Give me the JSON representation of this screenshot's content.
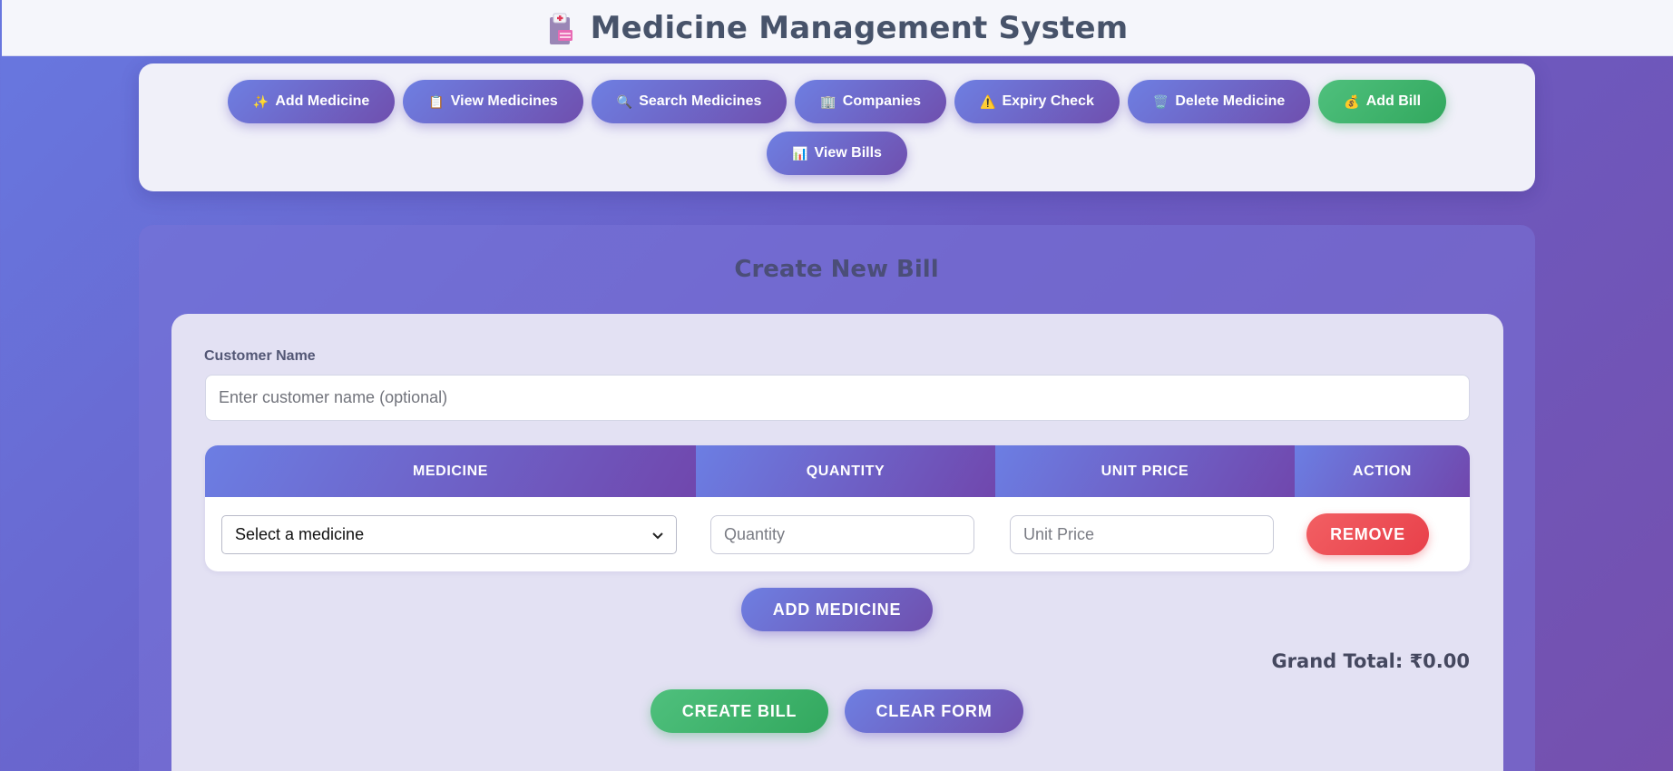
{
  "header": {
    "title": "Medicine Management System",
    "icon": "hospital-icon"
  },
  "nav": {
    "row1": [
      {
        "label": "Add Medicine",
        "icon": "sparkle-icon",
        "glyph": "✨"
      },
      {
        "label": "View Medicines",
        "icon": "clipboard-icon",
        "glyph": "📋"
      },
      {
        "label": "Search Medicines",
        "icon": "magnifier-icon",
        "glyph": "🔍"
      },
      {
        "label": "Companies",
        "icon": "building-icon",
        "glyph": "🏢"
      },
      {
        "label": "Expiry Check",
        "icon": "warning-icon",
        "glyph": "⚠️"
      },
      {
        "label": "Delete Medicine",
        "icon": "trash-icon",
        "glyph": "🗑️"
      },
      {
        "label": "Add Bill",
        "icon": "money-bag-icon",
        "glyph": "💰"
      }
    ],
    "row2": [
      {
        "label": "View Bills",
        "icon": "bar-chart-icon",
        "glyph": "📊"
      }
    ]
  },
  "form": {
    "heading": "Create New Bill",
    "customer_label": "Customer Name",
    "customer_placeholder": "Enter customer name (optional)",
    "customer_value": "",
    "table": {
      "columns": [
        "MEDICINE",
        "QUANTITY",
        "UNIT PRICE",
        "ACTION"
      ],
      "row": {
        "medicine_selected": "Select a medicine",
        "quantity_placeholder": "Quantity",
        "unit_price_placeholder": "Unit Price",
        "remove_label": "REMOVE"
      }
    },
    "add_medicine_label": "ADD MEDICINE",
    "grand_total": "Grand Total: ₹0.00",
    "create_bill_label": "CREATE BILL",
    "clear_form_label": "CLEAR FORM"
  },
  "colors": {
    "primary_gradient_start": "#6e7fe2",
    "primary_gradient_end": "#6f4fae",
    "success": "#3ab46a",
    "danger": "#ea4a52",
    "text_dark": "#47536a"
  }
}
